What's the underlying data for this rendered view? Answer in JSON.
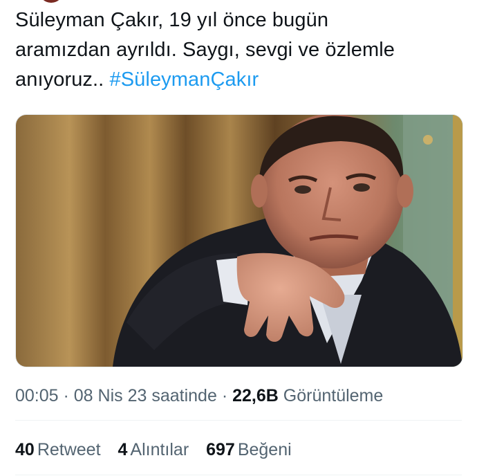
{
  "tweet": {
    "text_lines": [
      "Süleyman Çakır, 19 yıl önce bugün",
      "aramızdan ayrıldı. Saygı, sevgi ve özlemle",
      "anıyoruz.. "
    ],
    "hashtag": "#SüleymanÇakır"
  },
  "meta": {
    "time": "00:05",
    "sep1": " · ",
    "date": "08 Nis 23 saatinde",
    "sep2": " · ",
    "views_count": "22,6B",
    "views_label": "Görüntüleme"
  },
  "stats": {
    "retweets": {
      "count": "40",
      "label": "Retweet"
    },
    "quotes": {
      "count": "4",
      "label": "Alıntılar"
    },
    "likes": {
      "count": "697",
      "label": "Beğeni"
    }
  },
  "colors": {
    "accent": "#1d9bf0",
    "text": "#0f1419",
    "secondary": "#536471"
  }
}
